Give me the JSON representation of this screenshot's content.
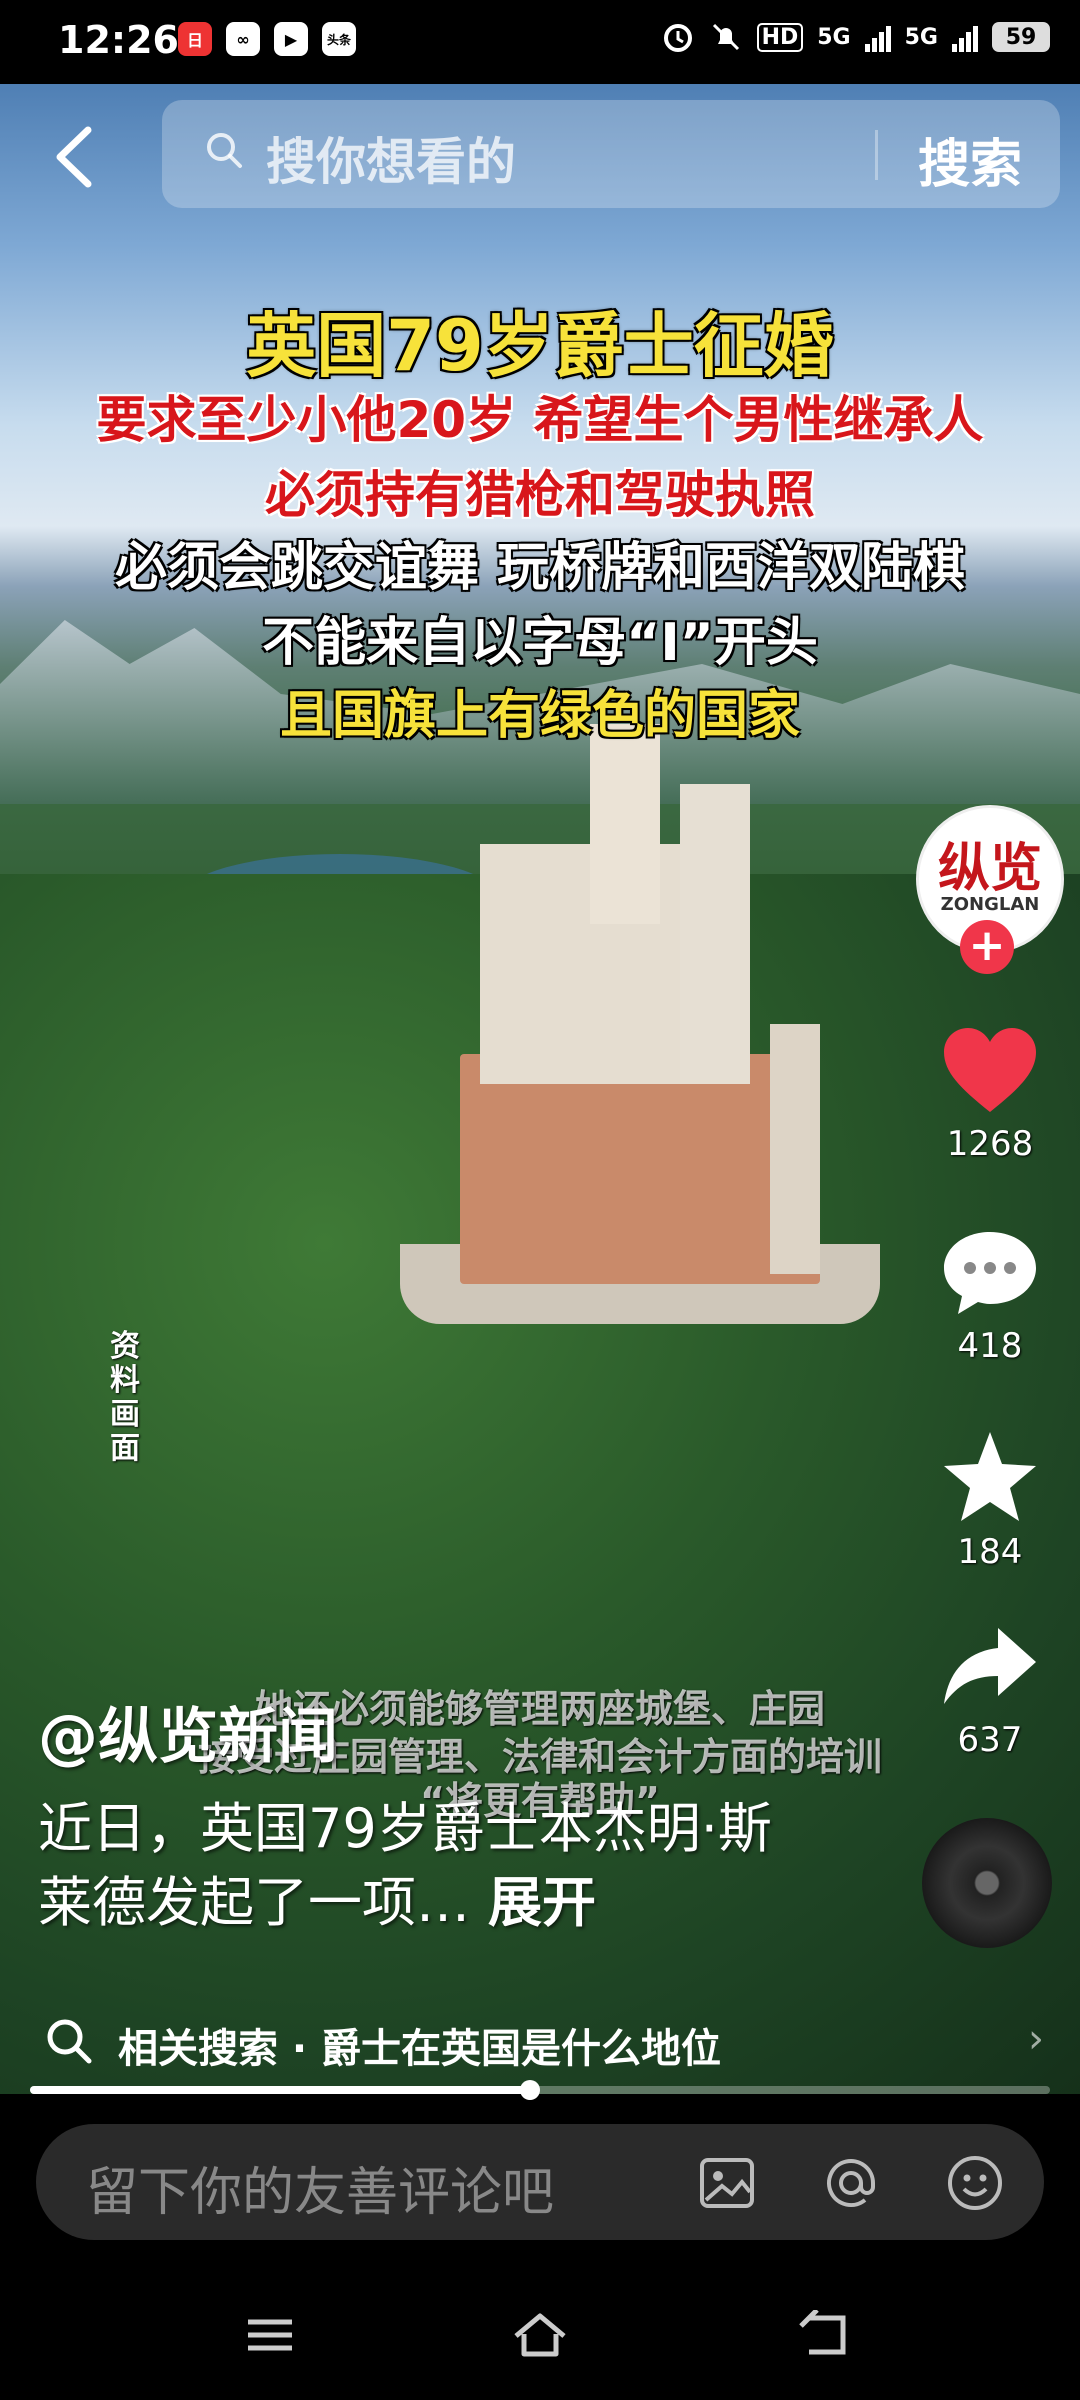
{
  "status_bar": {
    "time": "12:26",
    "app_icons": [
      "日",
      "∞",
      "▶",
      "头条"
    ],
    "network_1": "5G",
    "network_2": "5G",
    "hd_label": "HD",
    "battery": "59"
  },
  "search": {
    "placeholder": "搜你想看的",
    "button_label": "搜索"
  },
  "headline": {
    "line1": "英国79岁爵士征婚",
    "line2": "要求至少小他20岁 希望生个男性继承人",
    "line3": "必须持有猎枪和驾驶执照",
    "line4": "必须会跳交谊舞 玩桥牌和西洋双陆棋",
    "line5": "不能来自以字母“I”开头",
    "line6": "且国旗上有绿色的国家"
  },
  "source_tag": "资料画面",
  "account": {
    "avatar_text": "纵览",
    "avatar_sub": "ZONGLAN",
    "follow_label": "+"
  },
  "actions": {
    "likes": "1268",
    "comments": "418",
    "favorites": "184",
    "shares": "637"
  },
  "subtitle_overlay": {
    "line1": "她还必须能够管理两座城堡、庄园",
    "line2": "接受过庄园管理、法律和会计方面的培训",
    "line3": "“将更有帮助”"
  },
  "post": {
    "author": "@纵览新闻",
    "description": "近日，英国79岁爵士本杰明·斯莱德发起了一项…",
    "expand_label": "展开"
  },
  "related_search": {
    "text": "相关搜索 · 爵士在英国是什么地位"
  },
  "progress": {
    "fraction": 0.49
  },
  "comment_bar": {
    "placeholder": "留下你的友善评论吧"
  },
  "colors": {
    "headline_yellow": "#f7e23a",
    "headline_red": "#d8161b",
    "like_red": "#f0364a",
    "comment_bar_bg": "#2a2a2a"
  }
}
